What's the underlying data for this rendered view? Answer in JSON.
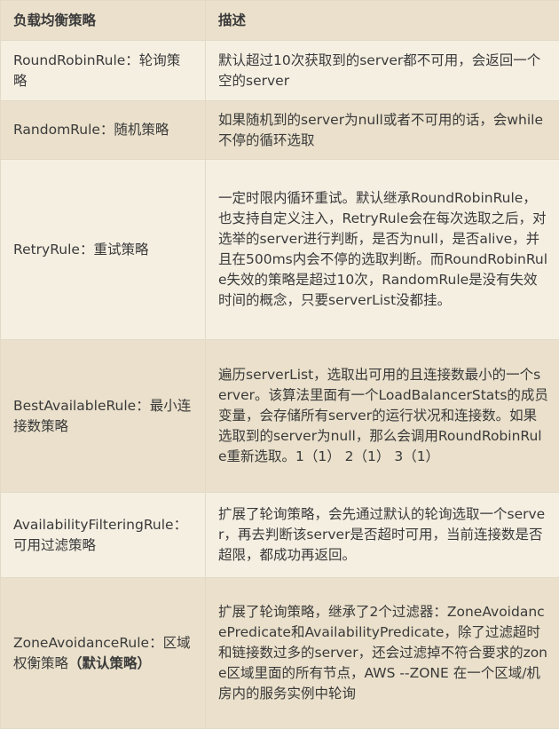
{
  "table": {
    "headers": [
      "负载均衡策略",
      "描述"
    ],
    "rows": [
      {
        "name": "RoundRobinRule：轮询策略",
        "note": "",
        "desc": "默认超过10次获取到的server都不可用，会返回一个空的server"
      },
      {
        "name": "RandomRule：随机策略",
        "note": "",
        "desc": "如果随机到的server为null或者不可用的话，会while不停的循环选取"
      },
      {
        "name": "RetryRule：重试策略",
        "note": "",
        "desc": "一定时限内循环重试。默认继承RoundRobinRule，也支持自定义注入，RetryRule会在每次选取之后，对选举的server进行判断，是否为null，是否alive，并且在500ms内会不停的选取判断。而RoundRobinRule失效的策略是超过10次，RandomRule是没有失效时间的概念，只要serverList没都挂。"
      },
      {
        "name": "BestAvailableRule：最小连接数策略",
        "note": "",
        "desc": "遍历serverList，选取出可用的且连接数最小的一个server。该算法里面有一个LoadBalancerStats的成员变量，会存储所有server的运行状况和连接数。如果选取到的server为null，那么会调用RoundRobinRule重新选取。1（1） 2（1） 3（1）"
      },
      {
        "name": "AvailabilityFilteringRule：可用过滤策略",
        "note": "",
        "desc": "扩展了轮询策略，会先通过默认的轮询选取一个server，再去判断该server是否超时可用，当前连接数是否超限，都成功再返回。"
      },
      {
        "name": "ZoneAvoidanceRule：区域权衡策略",
        "note": "（默认策略）",
        "desc": "扩展了轮询策略，继承了2个过滤器：ZoneAvoidancePredicate和AvailabilityPredicate，除了过滤超时和链接数过多的server，还会过滤掉不符合要求的zone区域里面的所有节点，AWS --ZONE 在一个区域/机房内的服务实例中轮询"
      }
    ]
  }
}
